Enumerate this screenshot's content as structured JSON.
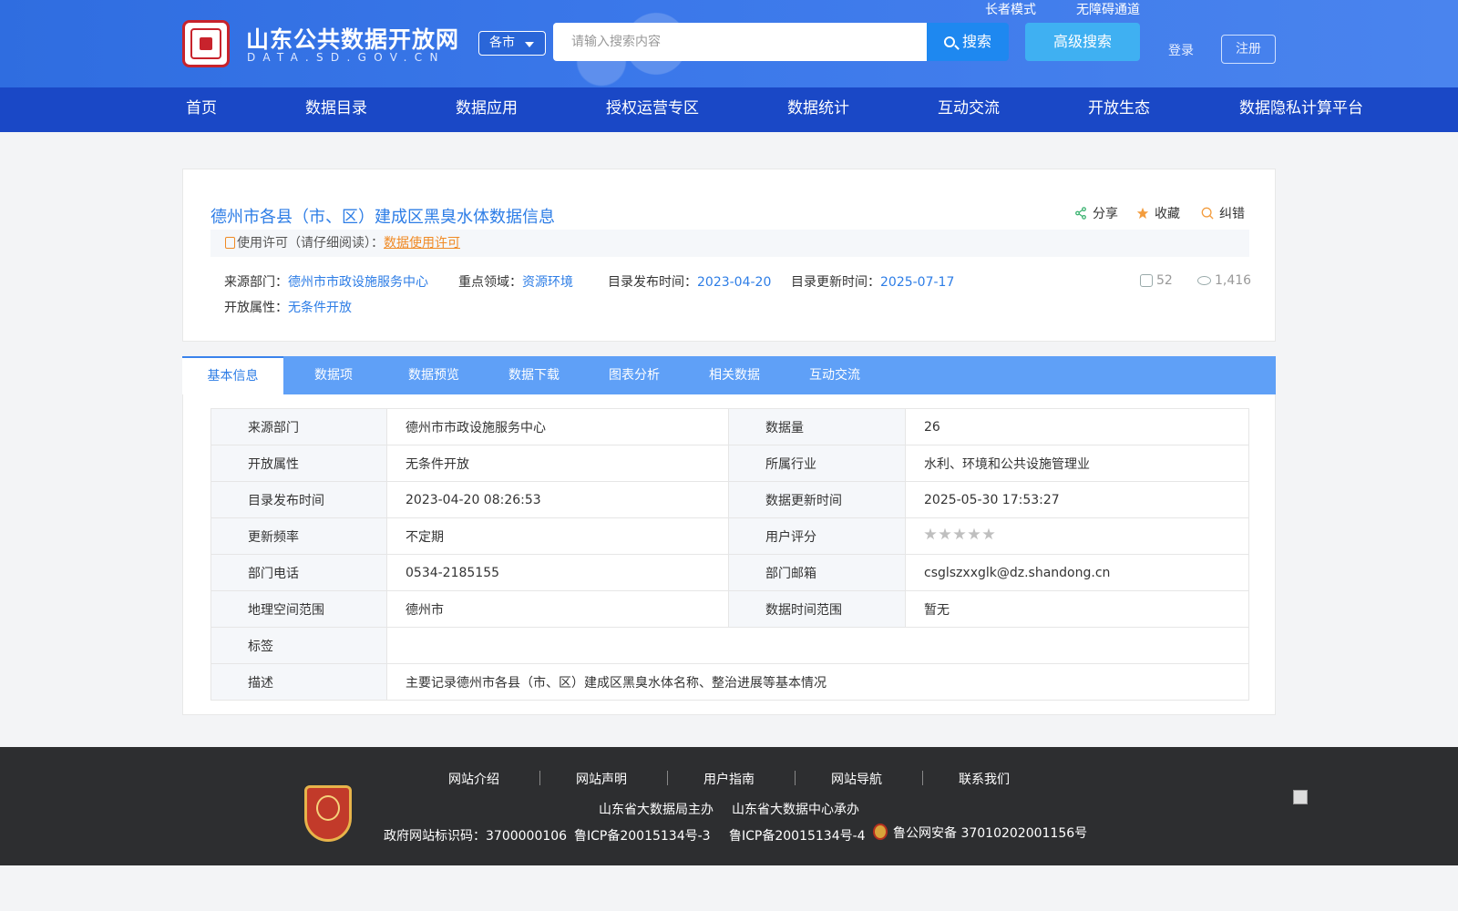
{
  "header": {
    "site_title": "山东公共数据开放网",
    "site_subtitle": "DATA.SD.GOV.CN",
    "logo_text": "",
    "city_select": "各市",
    "search_placeholder": "请输入搜索内容",
    "search_label": "搜索",
    "advanced_search_label": "高级搜索",
    "elder_mode": "长者模式",
    "accessibility": "无障碍通道",
    "login": "登录",
    "register": "注册",
    "colors": {
      "header_bg": "#3b78ea",
      "nav_bg": "#1a48c6",
      "search_btn": "#1e88f0",
      "adv_btn": "#3fb0f2"
    }
  },
  "nav": {
    "items": [
      "首页",
      "数据目录",
      "数据应用",
      "授权运营专区",
      "数据统计",
      "互动交流",
      "开放生态",
      "数据隐私计算平台"
    ]
  },
  "dataset": {
    "title": "德州市各县（市、区）建成区黑臭水体数据信息",
    "actions": {
      "share": "分享",
      "favorite": "收藏",
      "report_error": "纠错"
    },
    "license_prefix": "使用许可（请仔细阅读）：",
    "license_link": "数据使用许可",
    "source_dept_label": "来源部门：",
    "source_dept": "德州市市政设施服务中心",
    "focus_area_label": "重点领域：",
    "focus_area": "资源环境",
    "publish_time_label": "目录发布时间：",
    "publish_time": "2023-04-20",
    "update_time_label": "目录更新时间：",
    "update_time": "2025-07-17",
    "open_attr_label": "开放属性：",
    "open_attr": "无条件开放",
    "downloads": "52",
    "views": "1,416",
    "colors": {
      "title": "#2d7de6",
      "license": "#f08a24"
    }
  },
  "tabs": {
    "items": [
      "基本信息",
      "数据项",
      "数据预览",
      "数据下载",
      "图表分析",
      "相关数据",
      "互动交流"
    ],
    "active": "基本信息"
  },
  "details": {
    "rows": [
      {
        "k1": "来源部门",
        "v1": "德州市市政设施服务中心",
        "k2": "数据量",
        "v2": "26"
      },
      {
        "k1": "开放属性",
        "v1": "无条件开放",
        "k2": "所属行业",
        "v2": "水利、环境和公共设施管理业"
      },
      {
        "k1": "目录发布时间",
        "v1": "2023-04-20 08:26:53",
        "k2": "数据更新时间",
        "v2": "2025-05-30 17:53:27"
      },
      {
        "k1": "更新频率",
        "v1": "不定期",
        "k2": "用户评分",
        "rating": 0,
        "rating_max": 5
      },
      {
        "k1": "部门电话",
        "v1": "0534-2185155",
        "k2": "部门邮箱",
        "v2": "csglszxxglk@dz.shandong.cn"
      },
      {
        "k1": "地理空间范围",
        "v1": "德州市",
        "k2": "数据时间范围",
        "v2": "暂无"
      }
    ],
    "tags_label": "标签",
    "tags_value": "",
    "desc_label": "描述",
    "desc_value": "主要记录德州市各县（市、区）建成区黑臭水体名称、整治进展等基本情况"
  },
  "footer": {
    "links": [
      "网站介绍",
      "网站声明",
      "用户指南",
      "网站导航",
      "联系我们"
    ],
    "host": "山东省大数据局主办",
    "undertaker": "山东省大数据中心承办",
    "gov_id": "政府网站标识码：3700000106",
    "icp1": "鲁ICP备20015134号-3",
    "icp2": "鲁ICP备20015134号-4",
    "police": "鲁公网安备 37010202001156号",
    "badge_text": ""
  }
}
